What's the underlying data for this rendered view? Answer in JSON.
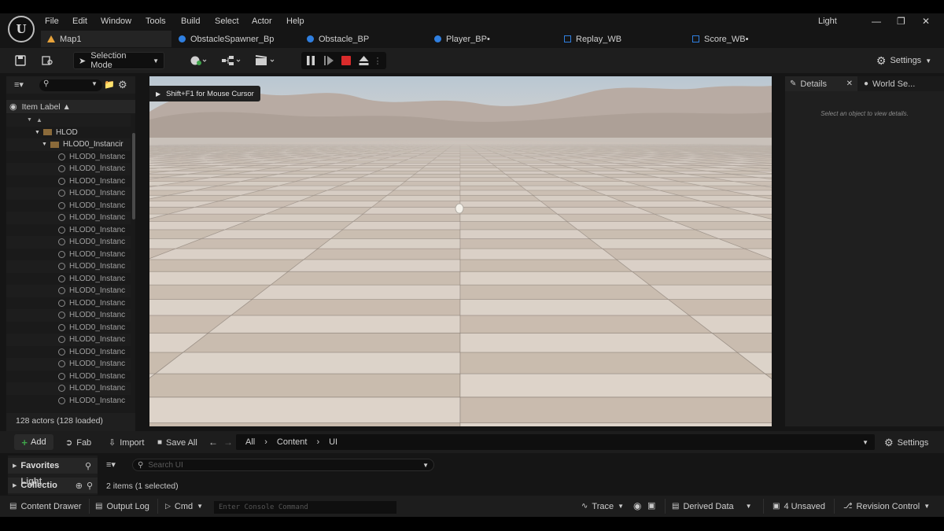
{
  "menu": {
    "items": [
      "File",
      "Edit",
      "Window",
      "Tools",
      "Build",
      "Select",
      "Actor",
      "Help"
    ],
    "right_label": "Light"
  },
  "tabs": [
    {
      "label": "Map1",
      "icon": "level-icon",
      "active": true
    },
    {
      "label": "ObstacleSpawner_Bp",
      "icon": "blueprint-icon"
    },
    {
      "label": "Obstacle_BP",
      "icon": "blueprint-icon"
    },
    {
      "label": "Player_BP•",
      "icon": "blueprint-icon"
    },
    {
      "label": "Replay_WB",
      "icon": "widget-icon"
    },
    {
      "label": "Score_WB•",
      "icon": "widget-icon"
    }
  ],
  "toolbar": {
    "selection_mode": "Selection Mode",
    "settings": "Settings"
  },
  "outliner": {
    "column_label": "Item Label ▲",
    "folder": "HLOD",
    "subfolder": "HLOD0_Instancir",
    "item_label": "HLOD0_Instanc",
    "actor_count": "128 actors (128 loaded)"
  },
  "viewport": {
    "hint": "Shift+F1 for Mouse Cursor"
  },
  "details": {
    "tab_details": "Details",
    "tab_world": "World Se...",
    "empty_message": "Select an object to view details."
  },
  "content_browser": {
    "add": "Add",
    "fab": "Fab",
    "import": "Import",
    "save_all": "Save All",
    "path": [
      "All",
      "Content",
      "UI"
    ],
    "settings": "Settings",
    "favorites": "Favorites",
    "collections": "Collectio",
    "light_label": "Light",
    "search_placeholder": "Search UI",
    "item_count": "2 items (1 selected)"
  },
  "statusbar": {
    "content_drawer": "Content Drawer",
    "output_log": "Output Log",
    "cmd": "Cmd",
    "console_placeholder": "Enter Console Command",
    "trace": "Trace",
    "derived_data": "Derived Data",
    "unsaved": "4 Unsaved",
    "revision_control": "Revision Control"
  },
  "colors": {
    "accent_blue": "#2f7fe0",
    "play_red": "#d92b2b",
    "add_green": "#3ea34a",
    "tab_orange": "#e8a33a"
  }
}
